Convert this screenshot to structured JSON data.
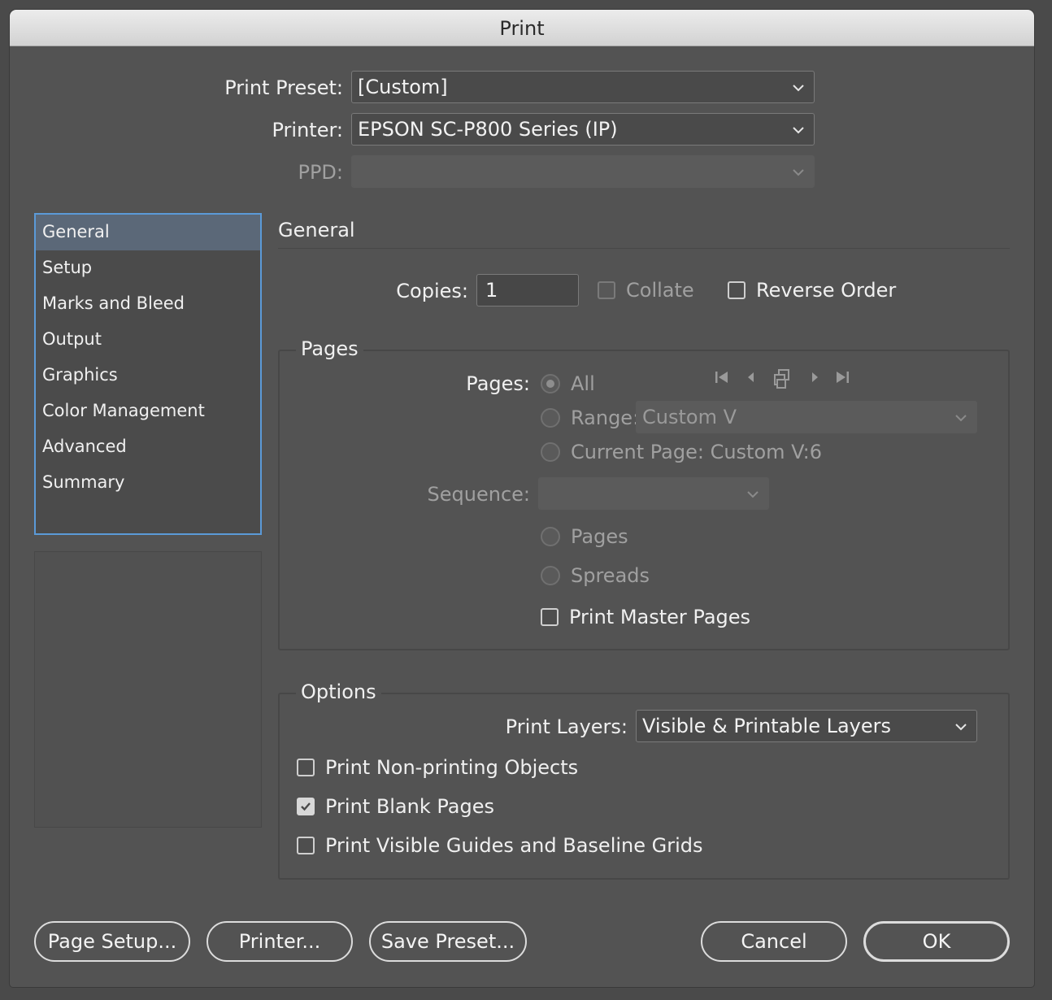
{
  "window": {
    "title": "Print"
  },
  "header": {
    "print_preset": {
      "label": "Print Preset:",
      "value": "[Custom]"
    },
    "printer": {
      "label": "Printer:",
      "value": "EPSON SC-P800 Series (IP)"
    },
    "ppd": {
      "label": "PPD:",
      "value": ""
    }
  },
  "sidebar": {
    "items": [
      {
        "label": "General"
      },
      {
        "label": "Setup"
      },
      {
        "label": "Marks and Bleed"
      },
      {
        "label": "Output"
      },
      {
        "label": "Graphics"
      },
      {
        "label": "Color Management"
      },
      {
        "label": "Advanced"
      },
      {
        "label": "Summary"
      }
    ],
    "selected": "General"
  },
  "general": {
    "title": "General",
    "copies": {
      "label": "Copies:",
      "value": "1"
    },
    "collate": {
      "label": "Collate",
      "checked": false,
      "enabled": false
    },
    "reverse_order": {
      "label": "Reverse Order",
      "checked": false
    }
  },
  "pages": {
    "title": "Pages",
    "pages_label": "Pages:",
    "all": {
      "label": "All",
      "selected": true
    },
    "range": {
      "label": "Range:",
      "value": "Custom V"
    },
    "current_page": {
      "label": "Current Page: Custom V:6"
    },
    "sequence": {
      "label": "Sequence:",
      "value": ""
    },
    "pages_option": {
      "label": "Pages"
    },
    "spreads_option": {
      "label": "Spreads"
    },
    "print_master_pages": {
      "label": "Print Master Pages",
      "checked": false
    }
  },
  "options": {
    "title": "Options",
    "print_layers": {
      "label": "Print Layers:",
      "value": "Visible & Printable Layers"
    },
    "non_printing": {
      "label": "Print Non-printing Objects",
      "checked": false
    },
    "blank_pages": {
      "label": "Print Blank Pages",
      "checked": true
    },
    "guides": {
      "label": "Print Visible Guides and Baseline Grids",
      "checked": false
    }
  },
  "buttons": {
    "page_setup": "Page Setup...",
    "printer": "Printer...",
    "save_preset": "Save Preset...",
    "cancel": "Cancel",
    "ok": "OK"
  }
}
